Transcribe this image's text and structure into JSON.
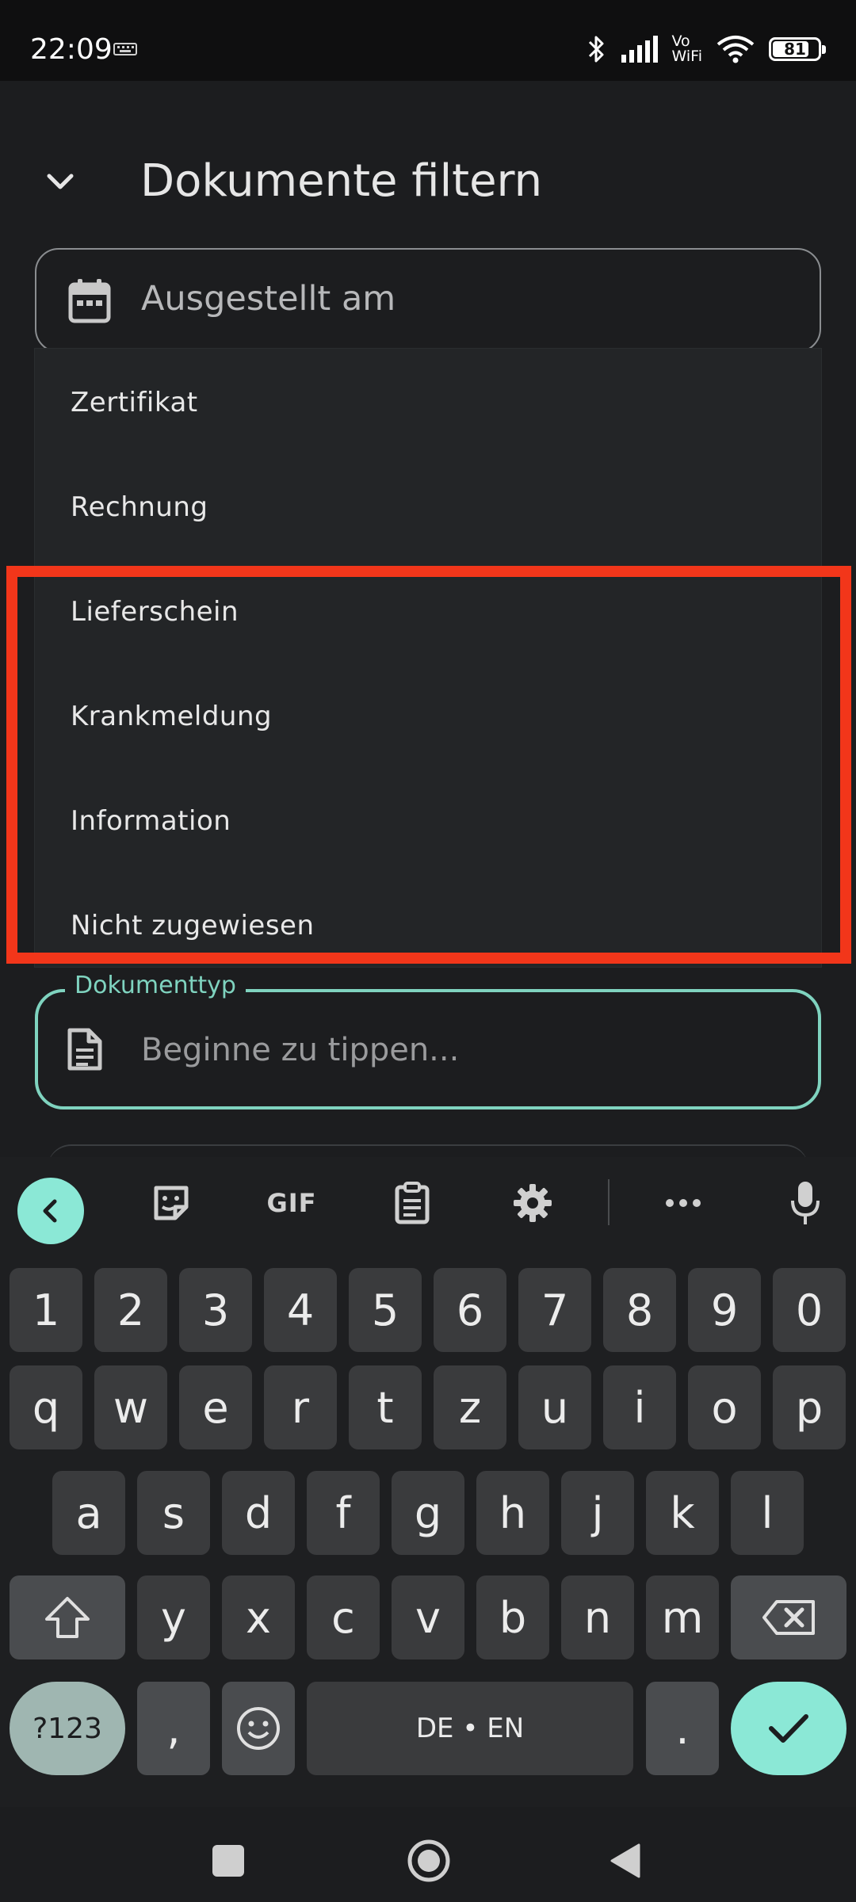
{
  "status_bar": {
    "time": "22:09",
    "network_label_line1": "Vo",
    "network_label_line2": "WiFi",
    "battery_percent": 81,
    "battery_text": "81"
  },
  "header": {
    "title": "Dokumente filtern"
  },
  "date_field": {
    "placeholder": "Ausgestellt am"
  },
  "dropdown": {
    "items": [
      {
        "label": "Zertifikat"
      },
      {
        "label": "Rechnung"
      },
      {
        "label": "Lieferschein"
      },
      {
        "label": "Krankmeldung"
      },
      {
        "label": "Information"
      },
      {
        "label": "Nicht zugewiesen"
      }
    ]
  },
  "type_field": {
    "label": "Dokumenttyp",
    "placeholder": "Beginne zu tippen..."
  },
  "keyboard": {
    "toolbar": [
      "back-icon",
      "sticker-icon",
      "gif",
      "clipboard-icon",
      "settings-icon",
      "more-icon",
      "mic-icon"
    ],
    "gif_label": "GIF",
    "more_label": "•••",
    "row_numbers": [
      "1",
      "2",
      "3",
      "4",
      "5",
      "6",
      "7",
      "8",
      "9",
      "0"
    ],
    "row1": [
      "q",
      "w",
      "e",
      "r",
      "t",
      "z",
      "u",
      "i",
      "o",
      "p"
    ],
    "row2": [
      "a",
      "s",
      "d",
      "f",
      "g",
      "h",
      "j",
      "k",
      "l"
    ],
    "row3": [
      "y",
      "x",
      "c",
      "v",
      "b",
      "n",
      "m"
    ],
    "symbols_label": "?123",
    "comma_label": ",",
    "space_label": "DE • EN",
    "period_label": ".",
    "accent_color": "#8be8d6"
  },
  "colors": {
    "highlight": "#f2361a",
    "field_focus": "#7fd3bf"
  }
}
